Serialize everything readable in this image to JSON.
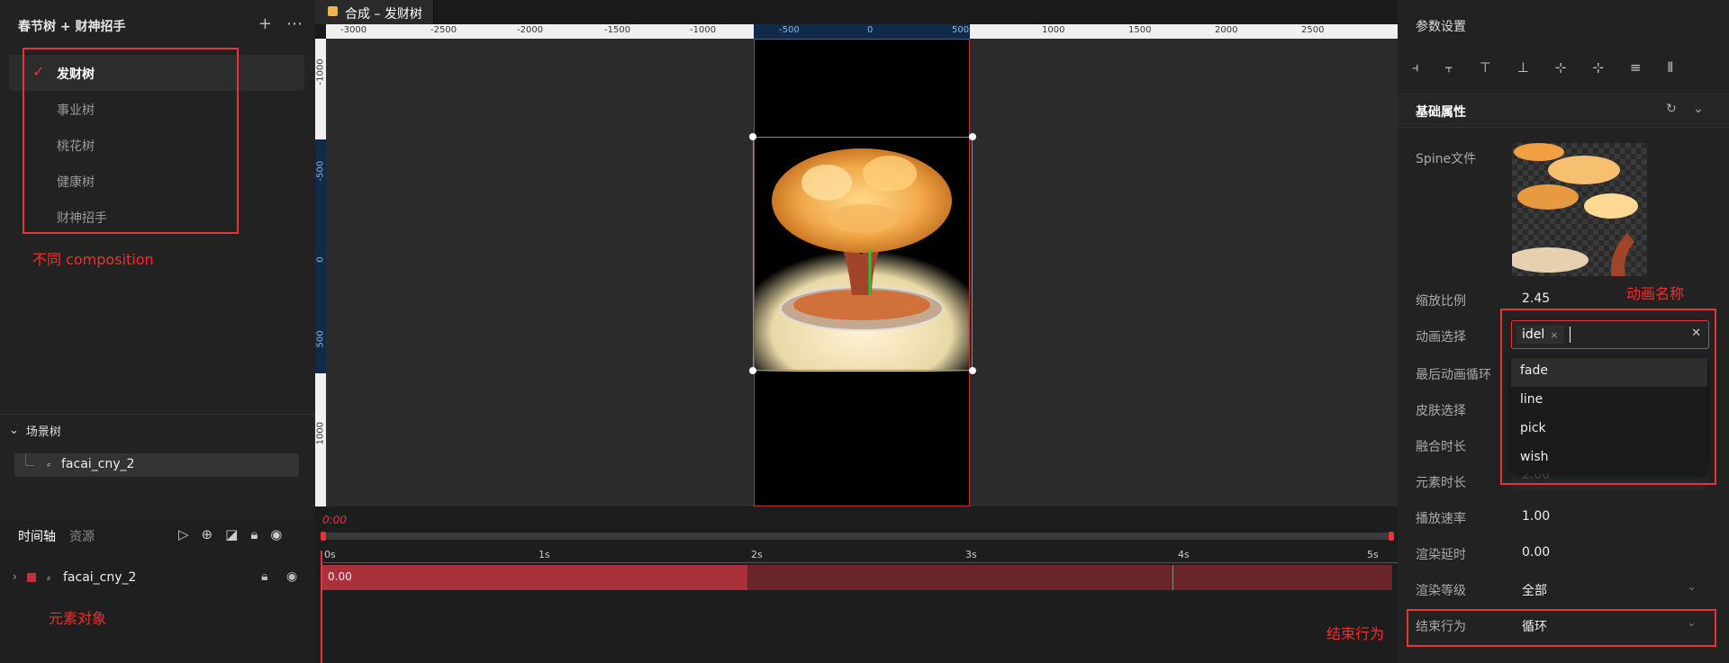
{
  "left_panel": {
    "title": "春节树 + 财神招手",
    "compositions": [
      {
        "label": "发财树",
        "active": true
      },
      {
        "label": "事业树",
        "active": false
      },
      {
        "label": "桃花树",
        "active": false
      },
      {
        "label": "健康树",
        "active": false
      },
      {
        "label": "财神招手",
        "active": false
      }
    ],
    "note_compositions": "不同 composition",
    "scene_tree_title": "场景树",
    "scene_item": "facai_cny_2"
  },
  "timeline_left": {
    "tab_timeline": "时间轴",
    "tab_assets": "资源",
    "layer_name": "facai_cny_2",
    "note_element": "元素对象"
  },
  "editor": {
    "tab_title": "合成 – 发财树",
    "ruler_h": [
      "-3000",
      "-2500",
      "-2000",
      "-1500",
      "-1000",
      "-500",
      "0",
      "500",
      "1000",
      "1500",
      "2000",
      "2500"
    ],
    "ruler_v": [
      "-1000",
      "-500",
      "0",
      "500",
      "1000"
    ]
  },
  "timeline": {
    "current_time": "0:00",
    "marks": [
      "0s",
      "1s",
      "2s",
      "3s",
      "4s",
      "5s"
    ],
    "clip_value": "0.00"
  },
  "right_panel": {
    "title": "参数设置",
    "section": "基础属性",
    "spine_label": "Spine文件",
    "scale_label": "缩放比例",
    "scale_value": "2.45",
    "anim_label": "动画选择",
    "anim_tag": "idel",
    "last_loop_label": "最后动画循环",
    "skin_label": "皮肤选择",
    "blend_label": "融合时长",
    "element_dur_label": "元素时长",
    "element_dur_value": "2.00",
    "speed_label": "播放速率",
    "speed_value": "1.00",
    "delay_label": "渲染延时",
    "delay_value": "0.00",
    "level_label": "渲染等级",
    "level_value": "全部",
    "end_label": "结束行为",
    "end_value": "循环",
    "dropdown_options": [
      "fade",
      "line",
      "pick",
      "wish"
    ],
    "note_anim_name": "动画名称",
    "note_end_behavior": "结束行为"
  },
  "colors": {
    "accent_red": "#e8323c",
    "tab_dot": "#e8b64a",
    "clip_fill": "#a9313a"
  }
}
